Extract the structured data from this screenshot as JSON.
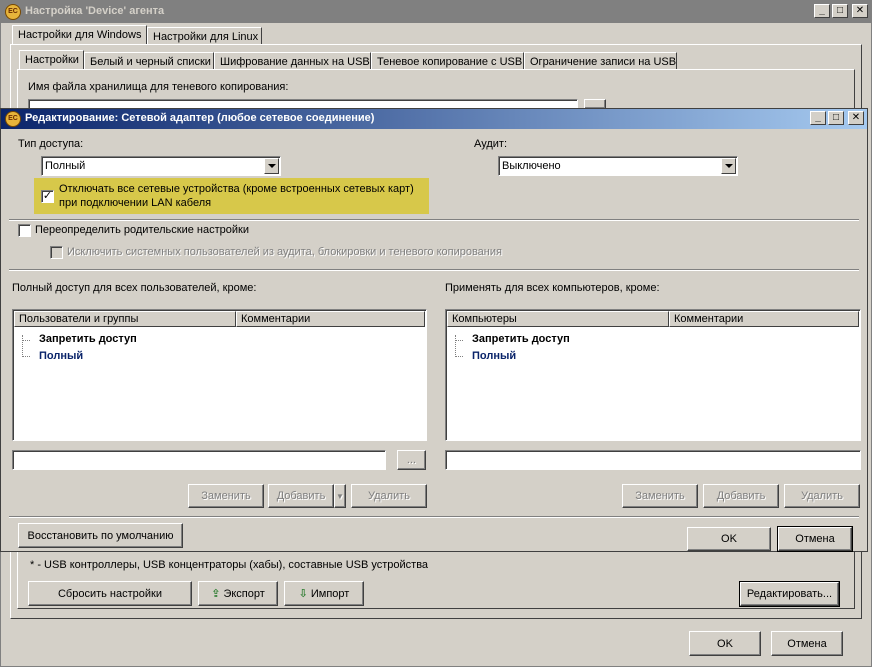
{
  "main_window": {
    "title": "Настройка 'Device' агента",
    "os_tabs": [
      "Настройки для Windows",
      "Настройки для Linux"
    ],
    "sub_tabs": [
      "Настройки",
      "Белый и черный списки",
      "Шифрование данных на USB",
      "Теневое копирование с USB",
      "Ограничение записи на USB"
    ],
    "storage_label": "Имя файла хранилища для теневого копирования:",
    "footnote": "* - USB контроллеры, USB концентраторы (хабы), составные USB устройства",
    "reset_button": "Сбросить настройки",
    "export_button": "Экспорт",
    "import_button": "Импорт",
    "edit_button": "Редактировать...",
    "ok_button": "OK",
    "cancel_button": "Отмена"
  },
  "dialog": {
    "title": "Редактирование: Сетевой адаптер (любое сетевое соединение)",
    "access_type_label": "Тип доступа:",
    "access_type_value": "Полный",
    "audit_label": "Аудит:",
    "audit_value": "Выключено",
    "disable_lan_checkbox": "Отключать все сетевые устройства (кроме встроенных сетевых карт)",
    "disable_lan_checkbox_line2": "при подключении LAN кабеля",
    "disable_lan_checked": true,
    "override_parent_label": "Переопределить родительские настройки",
    "override_parent_checked": false,
    "exclude_system_label": "Исключить системных пользователей из аудита, блокировки и теневого копирования",
    "left_section_title": "Полный доступ для всех пользователей, кроме:",
    "right_section_title": "Применять для всех компьютеров, кроме:",
    "left_columns": [
      "Пользователи и группы",
      "Комментарии"
    ],
    "right_columns": [
      "Компьютеры",
      "Комментарии"
    ],
    "tree_items": [
      "Запретить доступ",
      "Полный"
    ],
    "browse_button": "...",
    "replace_button": "Заменить",
    "add_button": "Добавить",
    "delete_button": "Удалить",
    "restore_defaults_button": "Восстановить по умолчанию",
    "ok_button": "OK",
    "cancel_button": "Отмена"
  },
  "colors": {
    "highlight": "#d7c84a",
    "tree_blue": "#0a246a",
    "title_active": "#0a246a"
  }
}
